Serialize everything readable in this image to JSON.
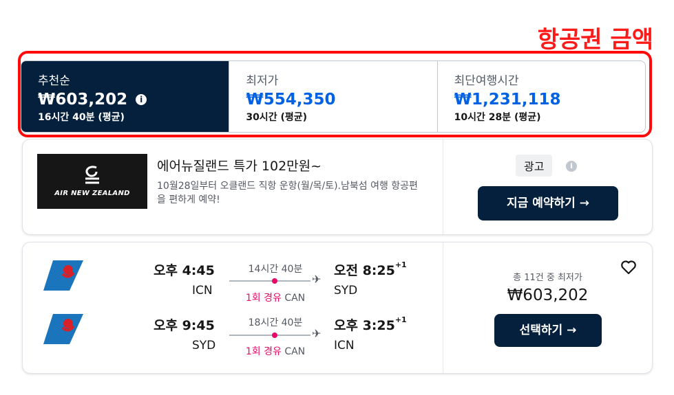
{
  "annotation": "항공권 금액",
  "sort_tabs": [
    {
      "label": "추천순",
      "price": "₩603,202",
      "duration": "16시간 40분 (평균)",
      "active": true
    },
    {
      "label": "최저가",
      "price": "₩554,350",
      "duration": "30시간 (평균)",
      "active": false
    },
    {
      "label": "최단여행시간",
      "price": "₩1,231,118",
      "duration": "10시간 28분 (평균)",
      "active": false
    }
  ],
  "ad": {
    "logo_text": "AIR NEW ZEALAND",
    "title": "에어뉴질랜드 특가 102만원~",
    "description": "10월28일부터 오클랜드 직항 운항(월/목/토).남북섬 여행 항공편을 편하게 예약!",
    "badge": "광고",
    "cta": "지금 예약하기 →"
  },
  "flight": {
    "legs": [
      {
        "depart_time": "오후 4:45",
        "depart_airport": "ICN",
        "duration": "14시간 40분",
        "stops": "1회 경유",
        "stop_airport": "CAN",
        "arrive_time": "오전 8:25",
        "arrive_offset": "+1",
        "arrive_airport": "SYD"
      },
      {
        "depart_time": "오후 9:45",
        "depart_airport": "SYD",
        "duration": "18시간 40분",
        "stops": "1회 경유",
        "stop_airport": "CAN",
        "arrive_time": "오후 3:25",
        "arrive_offset": "+1",
        "arrive_airport": "ICN"
      }
    ],
    "price_caption": "총 11건 중 최저가",
    "price": "₩603,202",
    "cta": "선택하기 →"
  },
  "colors": {
    "dark_navy": "#05203c",
    "accent_blue": "#0062e3",
    "stop_pink": "#e70866",
    "annotation_red": "#ff1a1a"
  },
  "icons": [
    "info-icon",
    "heart-icon",
    "airline-logo-icon",
    "plane-icon"
  ]
}
